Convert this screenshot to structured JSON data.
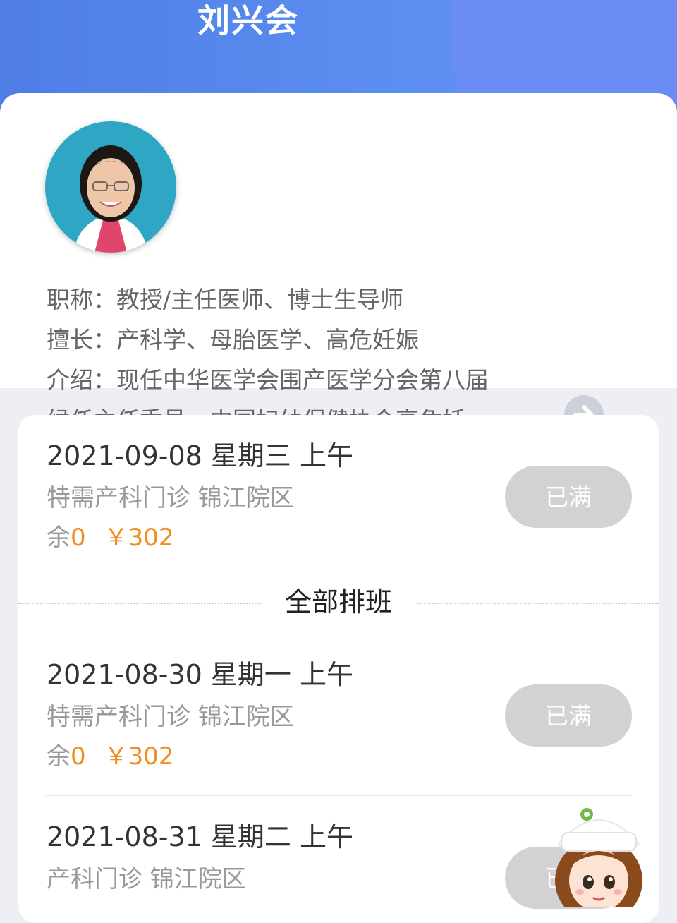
{
  "doctor": {
    "name": "刘兴会",
    "title_line": "职称：教授/主任医师、博士生导师",
    "specialty_line": "擅长：产科学、母胎医学、高危妊娠",
    "intro_line1": "介绍：现任中华医学会围产医学分会第八届",
    "intro_line2": "候任主任委员、中国妇幼保健协会高危妊..."
  },
  "schedule": {
    "all_label": "全部排班",
    "slots": [
      {
        "date": "2021-09-08 星期三  上午",
        "dept": "特需产科门诊  锦江院区",
        "remain_label": "余",
        "remain": "0",
        "fee": "￥302",
        "status": "已满"
      },
      {
        "date": "2021-08-30 星期一  上午",
        "dept": "特需产科门诊  锦江院区",
        "remain_label": "余",
        "remain": "0",
        "fee": "￥302",
        "status": "已满"
      },
      {
        "date": "2021-08-31 星期二  上午",
        "dept": "产科门诊  锦江院区",
        "status": "已满"
      }
    ]
  },
  "icons": {
    "more": "arrow-right-circle-icon",
    "assistant": "nurse-assistant-icon"
  },
  "colors": {
    "header": "#5b8ff0",
    "accent": "#ef8f23",
    "button_disabled": "#d2d2d4"
  }
}
